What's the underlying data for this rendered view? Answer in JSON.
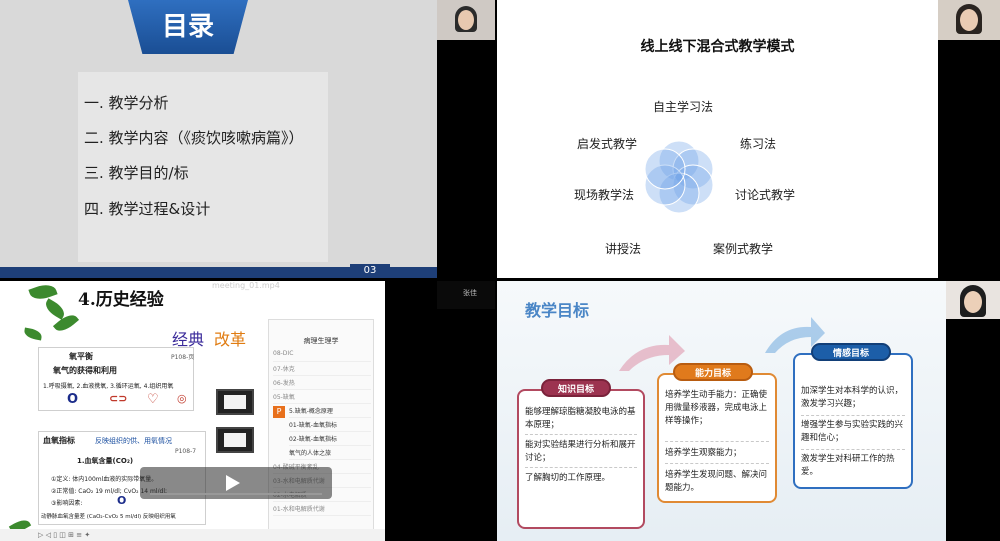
{
  "toc_slide": {
    "banner": "目录",
    "items": [
      "一.  教学分析",
      "二.  教学内容（《痰饮咳嗽病篇》）",
      "三.  教学目的/标",
      "四.  教学过程&设计"
    ],
    "page_number": "03"
  },
  "blend_slide": {
    "title": "线上线下混合式教学模式",
    "methods": [
      "自主学习法",
      "启发式教学",
      "练习法",
      "现场教学法",
      "讨论式教学",
      "讲授法",
      "案例式教学"
    ]
  },
  "history_slide": {
    "video_title": "meeting_01.mp4",
    "title": "4.历史经验",
    "classic_label": "经典",
    "reform_label": "改革",
    "box1": {
      "heading": "氧平衡",
      "page_ref": "P108-页",
      "subheading": "氧气的获得和利用",
      "line": "1.呼吸摄氧, 2.血液携氧, 3.循环运氧, 4.组织用氧"
    },
    "box2": {
      "heading": "血氧指标",
      "note": "反映组织的供、用氧情况",
      "page_ref": "P108-7",
      "item1": "1.血氧含量(CO₂)",
      "def": "①定义: 体内100ml血液的实际带氧量。",
      "normal": "②正常值: CaO₂ 19 ml/dl; CvO₂ 14 ml/dl;",
      "factors": "③影响因素:",
      "arterial": "动静脉血氧含量差 (CaO₂-CvO₂ 5 ml/dl) 反映组织用氧"
    },
    "phone": {
      "title": "病理生理学",
      "rows": [
        "08-DIC",
        "07-休克",
        "06-发热",
        "05-缺氧",
        "5.缺氧-概念原理",
        "01-缺氧-血氧指标",
        "02-缺氧-血氧指标",
        "氧气的人体之旅",
        "04-酸碱平衡紊乱",
        "03-水和电解质代谢",
        "02-水电解质",
        "01-水和电解质代谢"
      ]
    },
    "bottom_text": "▷ ◁ ▯ ◫ ⊞ ≡ ✦"
  },
  "goals_slide": {
    "title": "教学目标",
    "knowledge": {
      "label": "知识目标",
      "lines": [
        "能够理解琼脂糖凝胶电泳的基本原理；",
        "能对实验结果进行分析和展开讨论；",
        "了解胸切的工作原理。"
      ]
    },
    "ability": {
      "label": "能力目标",
      "lines": [
        "培养学生动手能力：正确使用微量移液器，完成电泳上样等操作；",
        "培养学生观察能力；",
        "培养学生发现问题、解决问题能力。"
      ]
    },
    "emotion": {
      "label": "情感目标",
      "lines": [
        "加深学生对本科学的认识，激发学习兴趣；",
        "增强学生参与实验实践的兴趣和信心；",
        "激发学生对科研工作的热爱。"
      ]
    }
  },
  "cams": {
    "cam3_label": "张佳"
  },
  "colors": {
    "toc_banner": "#2f6fc0",
    "footer_bar": "#1e3f78",
    "knowledge": "#9c3350",
    "ability": "#e07a1c",
    "emotion": "#1c5ea8"
  }
}
